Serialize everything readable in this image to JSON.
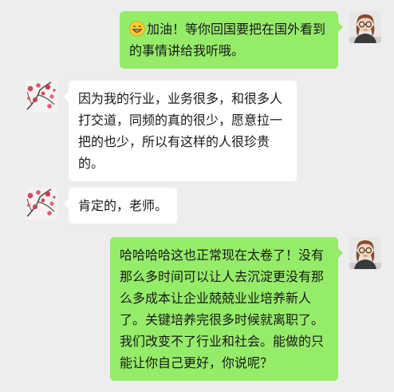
{
  "messages": [
    {
      "side": "right",
      "sender": "self",
      "avatar_icon": "person-with-glasses-avatar",
      "emoji": "grinning-face-emoji",
      "text": "加油！等你回国要把在国外看到的事情讲给我听哦。"
    },
    {
      "side": "left",
      "sender": "contact",
      "avatar_icon": "plum-blossom-avatar",
      "text": "因为我的行业，业务很多，和很多人打交道，同频的真的很少，愿意拉一把的也少，所以有这样的人很珍贵的。"
    },
    {
      "side": "left",
      "sender": "contact",
      "avatar_icon": "plum-blossom-avatar",
      "text": "肯定的，老师。"
    },
    {
      "side": "right",
      "sender": "self",
      "avatar_icon": "person-with-glasses-avatar",
      "text": "哈哈哈哈这也正常现在太卷了！没有那么多时间可以让人去沉淀更没有那么多成本让企业兢兢业业培养新人了。关键培养完很多时候就离职了。我们改变不了行业和社会。能做的只能让你自己更好，你说呢？"
    }
  ],
  "colors": {
    "background": "#ededed",
    "bubble_self": "#95ec69",
    "bubble_contact": "#ffffff"
  }
}
